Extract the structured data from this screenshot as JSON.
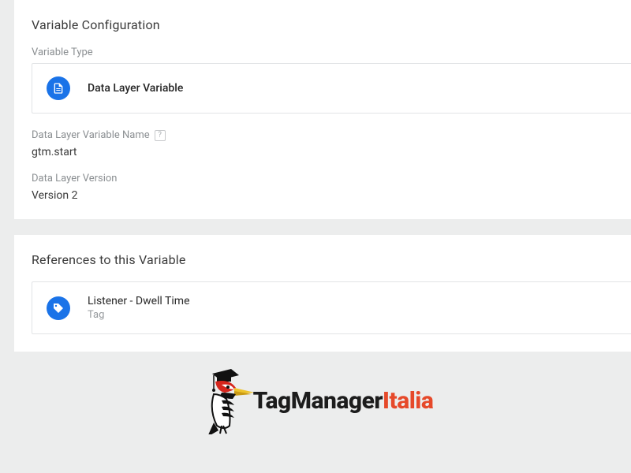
{
  "configPanel": {
    "title": "Variable Configuration",
    "typeLabel": "Variable Type",
    "typeName": "Data Layer Variable",
    "nameLabel": "Data Layer Variable Name",
    "nameValue": "gtm.start",
    "versionLabel": "Data Layer Version",
    "versionValue": "Version 2",
    "helpGlyph": "?"
  },
  "refsPanel": {
    "title": "References to this Variable",
    "items": [
      {
        "name": "Listener - Dwell Time",
        "kind": "Tag"
      }
    ]
  },
  "logo": {
    "part1": "TagManager",
    "part2": "Italia"
  }
}
